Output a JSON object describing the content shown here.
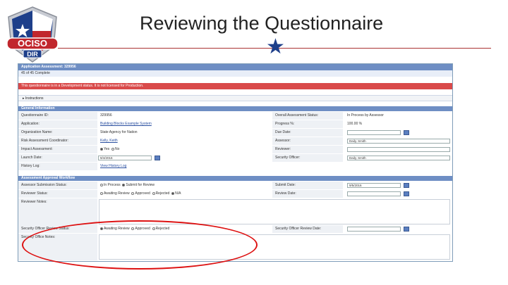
{
  "slide": {
    "title": "Reviewing the Questionnaire"
  },
  "logo": {
    "line1": "OCISO",
    "line2": "DIR"
  },
  "app": {
    "header": "Application Assessment: 329956",
    "progress_text": "45 of 45 Complete",
    "warning": "This questionnaire is in a Development status. It is not licensed for Production.",
    "instructions_label": "Instructions",
    "general_section": "General Information",
    "general_left": [
      {
        "label": "Questionnaire ID:",
        "value": "329956",
        "type": "text"
      },
      {
        "label": "Application:",
        "value": "Building Blocks Example System",
        "type": "link"
      },
      {
        "label": "Organization Name:",
        "value": "State Agency for Nation",
        "type": "text"
      },
      {
        "label": "Risk Assessment Coordinator:",
        "value": "Kelly, Keith",
        "type": "link"
      },
      {
        "label": "Impact Assessment:",
        "value_yes": "Yes",
        "value_no": "No",
        "type": "radio"
      },
      {
        "label": "Launch Date:",
        "value": "9/4/2016",
        "type": "date"
      },
      {
        "label": "History Log:",
        "value": "View History Log",
        "type": "link"
      }
    ],
    "general_right": [
      {
        "label": "Overall Assessment Status:",
        "value": "In Process by Assessor",
        "type": "text"
      },
      {
        "label": "Progress %:",
        "value": "100.00 %",
        "type": "text"
      },
      {
        "label": "Due Date:",
        "value": "",
        "type": "date"
      },
      {
        "label": "Assessor:",
        "value": "Daily, Smith",
        "type": "input"
      },
      {
        "label": "Reviewer:",
        "value": "",
        "type": "input"
      },
      {
        "label": "Security Officer:",
        "value": "Daily, Smith",
        "type": "input"
      }
    ],
    "approval_section": "Assessment Approval Workflow",
    "approval_rows": {
      "assessor_status": {
        "label": "Assessor Submission Status:",
        "opt1": "In Process",
        "opt2": "Submit for Review"
      },
      "reviewer_status": {
        "label": "Reviewer Status:",
        "opt1": "Awaiting Review",
        "opt2": "Approved",
        "opt3": "Rejected",
        "opt4": "N/A"
      },
      "reviewer_notes": {
        "label": "Reviewer Notes:"
      },
      "security_status": {
        "label": "Security Officer Review Status:",
        "opt1": "Awaiting Review",
        "opt2": "Approved",
        "opt3": "Rejected"
      },
      "security_notes": {
        "label": "Security Office Notes:"
      },
      "submit_date": {
        "label": "Submit Date:",
        "value": "9/5/2016"
      },
      "review_date": {
        "label": "Review Date:",
        "value": ""
      },
      "security_review_date": {
        "label": "Security Officer Review Date:",
        "value": ""
      }
    }
  },
  "colors": {
    "header": "#6e8ec4",
    "warning": "#d94a4a",
    "highlight": "#dd1111",
    "star": "#1e3f8a"
  }
}
